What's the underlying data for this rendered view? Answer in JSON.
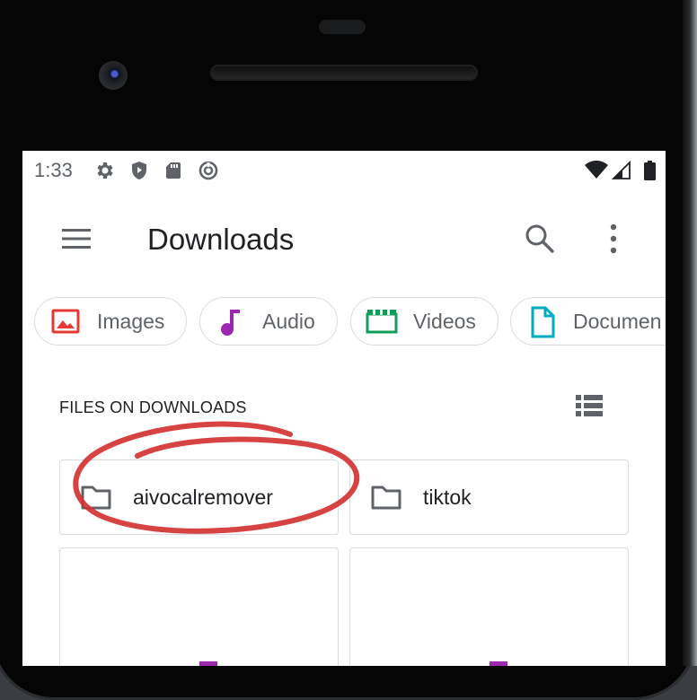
{
  "status_bar": {
    "time": "1:33",
    "notification_icons": [
      "gear-icon",
      "shield-icon",
      "sd-card-icon",
      "data-saver-icon"
    ],
    "system_icons": [
      "wifi-icon",
      "cell-signal-icon",
      "battery-icon"
    ]
  },
  "app_bar": {
    "menu_icon": "hamburger-menu-icon",
    "title": "Downloads",
    "actions": [
      "search-icon",
      "more-vert-icon"
    ]
  },
  "chips": [
    {
      "label": "Images",
      "icon": "image-icon",
      "color": "#e53935"
    },
    {
      "label": "Audio",
      "icon": "music-note-icon",
      "color": "#9c27b0"
    },
    {
      "label": "Videos",
      "icon": "movie-icon",
      "color": "#0f9d58"
    },
    {
      "label": "Documen",
      "icon": "document-icon",
      "color": "#00acc1"
    }
  ],
  "files": {
    "section_label": "FILES ON DOWNLOADS",
    "view_toggle_icon": "list-view-icon",
    "folders": [
      {
        "name": "aivocalremover",
        "icon": "folder-icon"
      },
      {
        "name": "tiktok",
        "icon": "folder-icon"
      }
    ],
    "annotation_color": "#d32f2f"
  }
}
